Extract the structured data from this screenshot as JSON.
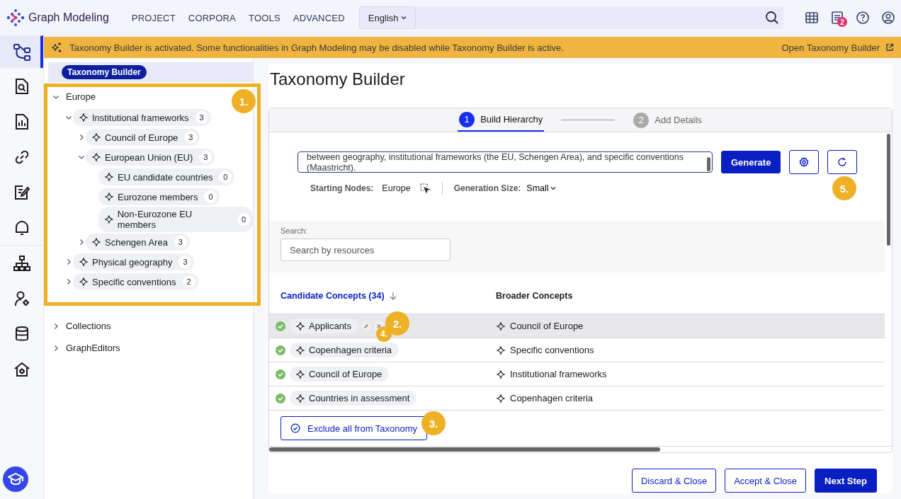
{
  "app": {
    "name": "Graph Modeling"
  },
  "menu": [
    {
      "label": "PROJECT"
    },
    {
      "label": "CORPORA"
    },
    {
      "label": "TOOLS"
    },
    {
      "label": "ADVANCED"
    }
  ],
  "language": {
    "value": "English"
  },
  "notifications": {
    "count": "2"
  },
  "rail": [
    {
      "kind": "flow",
      "selected": true
    },
    {
      "kind": "doc-search",
      "selected": false
    },
    {
      "kind": "doc-chart",
      "selected": false
    },
    {
      "kind": "link",
      "selected": false
    },
    {
      "kind": "doc-edit",
      "selected": false
    },
    {
      "kind": "bell",
      "selected": false
    },
    {
      "kind": "org",
      "selected": false
    },
    {
      "kind": "user-gear",
      "selected": false
    },
    {
      "kind": "database",
      "selected": false
    },
    {
      "kind": "house-gear",
      "selected": false
    }
  ],
  "banner": {
    "message": "Taxonomy Builder is activated. Some functionalities in Graph Modeling may be disabled while Taxonomy Builder is active.",
    "link": "Open Taxonomy Builder"
  },
  "tree": {
    "badge": "Taxonomy Builder",
    "roots": [
      {
        "label": "Europe",
        "expanded": true,
        "children": [
          {
            "label": "Institutional frameworks",
            "count": "3",
            "expanded": true,
            "children": [
              {
                "label": "Council of Europe",
                "count": "3",
                "expanded": false
              },
              {
                "label": "European Union (EU)",
                "count": "3",
                "expanded": true,
                "children": [
                  {
                    "label": "EU candidate countries",
                    "count": "0"
                  },
                  {
                    "label": "Eurozone members",
                    "count": "0"
                  },
                  {
                    "label": "Non-Eurozone EU members",
                    "count": "0"
                  }
                ]
              },
              {
                "label": "Schengen Area",
                "count": "3",
                "expanded": false
              }
            ]
          },
          {
            "label": "Physical geography",
            "count": "3",
            "expanded": false
          },
          {
            "label": "Specific conventions",
            "count": "2",
            "expanded": false
          }
        ]
      },
      {
        "label": "Collections",
        "expanded": false
      },
      {
        "label": "GraphEditors",
        "expanded": false
      }
    ]
  },
  "builder": {
    "title": "Taxonomy Builder",
    "steps": [
      {
        "number": "1",
        "label": "Build Hierarchy",
        "selected": true
      },
      {
        "number": "2",
        "label": "Add Details",
        "selected": false
      }
    ],
    "prompt": "between geography, institutional frameworks (the EU, Schengen Area), and specific conventions (Maastricht).",
    "generate": "Generate",
    "starting_nodes_label": "Starting Nodes:",
    "starting_nodes_value": "Europe",
    "generation_size_label": "Generation Size:",
    "generation_size_value": "Small",
    "search_label": "Search:",
    "search_placeholder": "Search by resources",
    "columns": [
      "Candidate Concepts (34)",
      "Broader Concepts"
    ],
    "rows": [
      {
        "concept": "Applicants",
        "broader": "Council of Europe",
        "selected": true,
        "editing": true
      },
      {
        "concept": "Copenhagen criteria",
        "broader": "Specific conventions",
        "selected": false,
        "editing": false
      },
      {
        "concept": "Council of Europe",
        "broader": "Institutional frameworks",
        "selected": false,
        "editing": false
      },
      {
        "concept": "Countries in assessment",
        "broader": "Copenhagen criteria",
        "selected": false,
        "editing": false
      }
    ],
    "exclude": "Exclude all from Taxonomy",
    "footer": [
      {
        "label": "Discard & Close",
        "kind": "outline"
      },
      {
        "label": "Accept & Close",
        "kind": "outline"
      },
      {
        "label": "Next Step",
        "kind": "primary"
      }
    ]
  },
  "annotations": [
    "1.",
    "2.",
    "3.",
    "4.",
    "5."
  ]
}
